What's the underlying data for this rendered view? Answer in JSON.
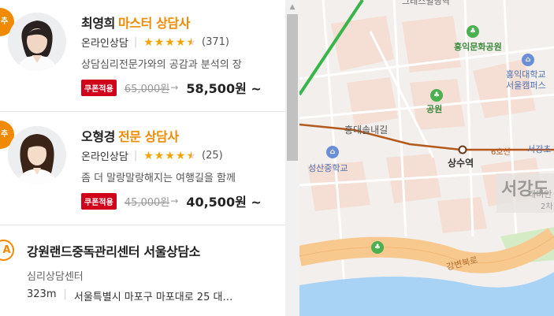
{
  "counselors": [
    {
      "badge": "추천",
      "name": "최영희",
      "grade": "마스터 상담사",
      "type": "온라인상담",
      "rating_stars": "★★★★★",
      "rating": 4.5,
      "review_count": "(371)",
      "description": "상담심리전문가와의 공감과 분석의 장",
      "coupon": "쿠폰적용",
      "original_price": "65,000원",
      "sale_price": "58,500원 ~"
    },
    {
      "badge": "추천",
      "name": "오형경",
      "grade": "전문 상담사",
      "type": "온라인상담",
      "rating_stars": "★★★★★",
      "rating": 4.5,
      "review_count": "(25)",
      "description": "좀 더 말랑말랑해지는 여행길을 함께",
      "coupon": "쿠폰적용",
      "original_price": "45,000원",
      "sale_price": "40,500원 ~"
    }
  ],
  "center": {
    "marker": "A",
    "title": "강원랜드중독관리센터 서울상담소",
    "category": "심리상담센터",
    "distance": "323m",
    "address": "서울특별시 마포구 마포대로 25 대…"
  },
  "map": {
    "labels": {
      "top_cut": "그레스빌딩역",
      "hongik_park": "홍익문화공원",
      "hongik_univ_1": "홍익대학교",
      "hongik_univ_2": "서울캠퍼스",
      "park": "공원",
      "hongdae_road": "홍대솔내길",
      "line6": "6호선",
      "sangsu": "상수역",
      "seogang": "서강초",
      "seongsan_school": "성산중학교",
      "seogang_big": "서강도",
      "raemian": "래미안",
      "num2": "2차",
      "riverside": "강변북로"
    },
    "colors": {
      "line6": "#b5581c",
      "line2": "#39b54a",
      "river": "#a9d3f5",
      "expressway": "#f8c98f",
      "green_icon": "#4caf50",
      "blue_icon": "#6a8fd8"
    }
  }
}
